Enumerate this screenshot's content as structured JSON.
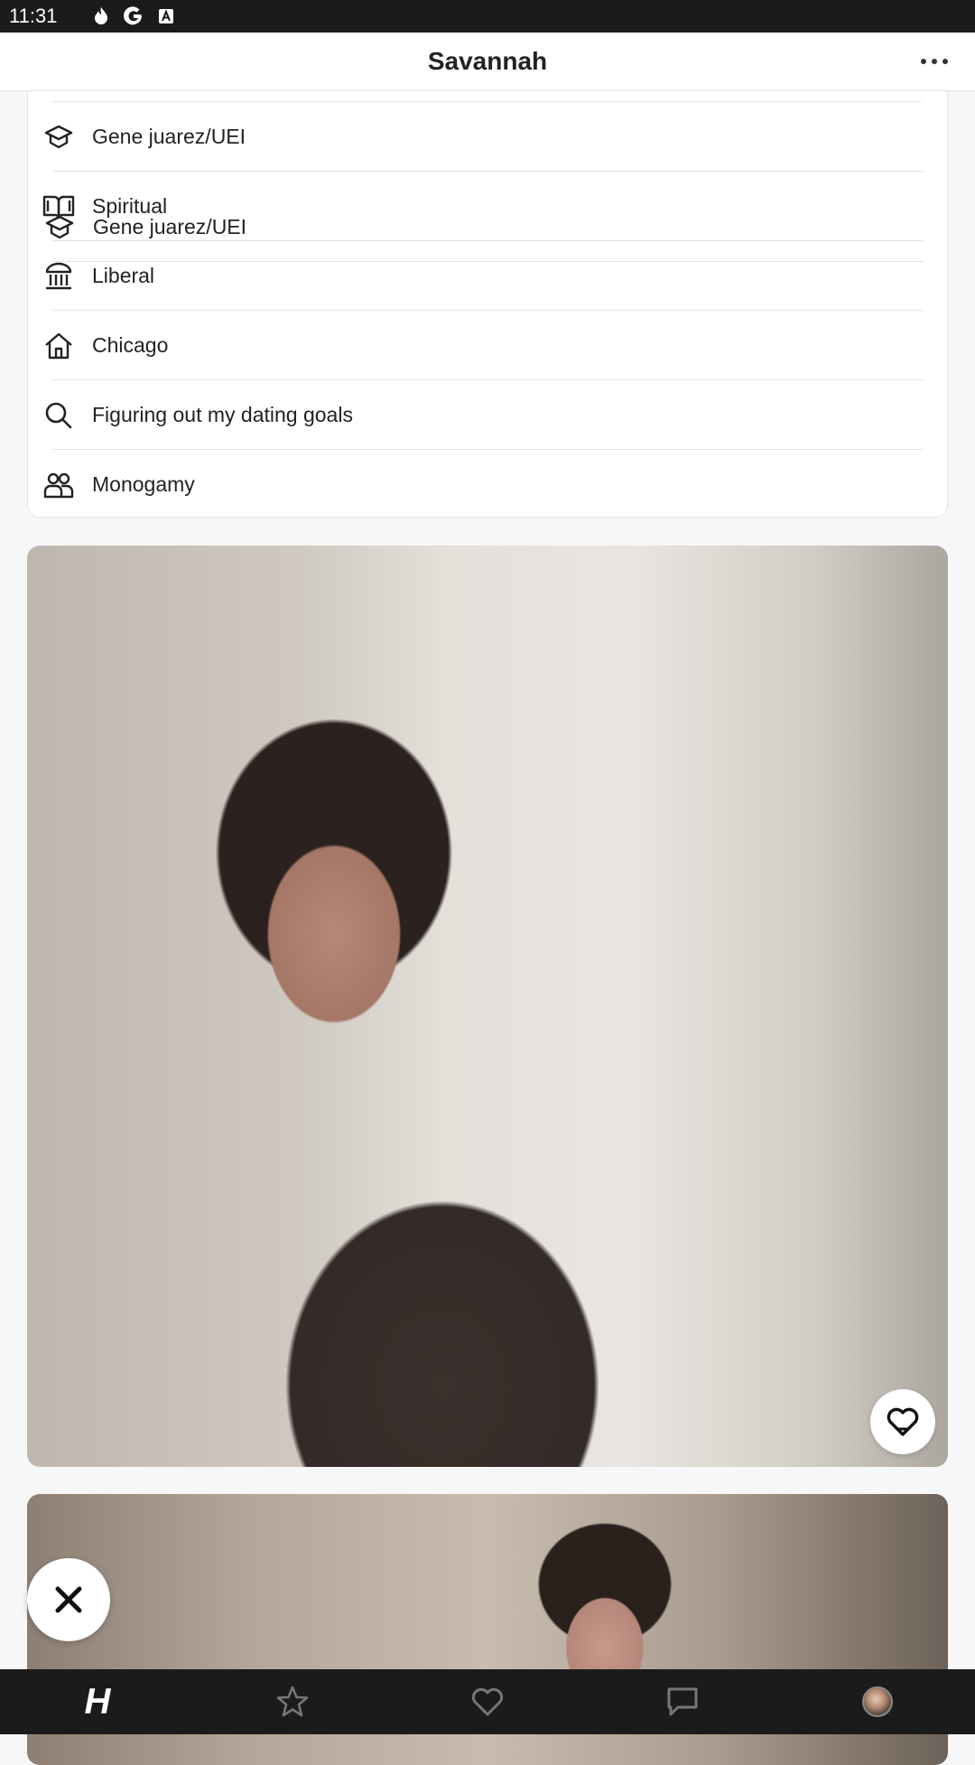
{
  "status_bar": {
    "time": "11:31",
    "icons": [
      "flame-icon",
      "google-icon",
      "font-a-icon"
    ]
  },
  "header": {
    "title": "Savannah",
    "more_icon": "more-horizontal-icon"
  },
  "profile_details": [
    {
      "icon": "graduation-cap-icon",
      "label": "Gene juarez/UEI"
    },
    {
      "icon": "book-open-icon",
      "label": "Spiritual"
    },
    {
      "icon": "institution-icon",
      "label": "Liberal"
    },
    {
      "icon": "home-icon",
      "label": "Chicago"
    },
    {
      "icon": "search-icon",
      "label": "Figuring out my dating goals"
    },
    {
      "icon": "people-icon",
      "label": "Monogamy"
    }
  ],
  "photos": [
    {
      "name": "profile-photo-1",
      "like_icon": "heart-icon"
    },
    {
      "name": "profile-photo-2"
    }
  ],
  "skip_button_icon": "close-icon",
  "bottom_nav": [
    "hinge-logo",
    "star-icon",
    "heart-icon",
    "chat-icon",
    "avatar"
  ],
  "nav_logo_text": "H"
}
